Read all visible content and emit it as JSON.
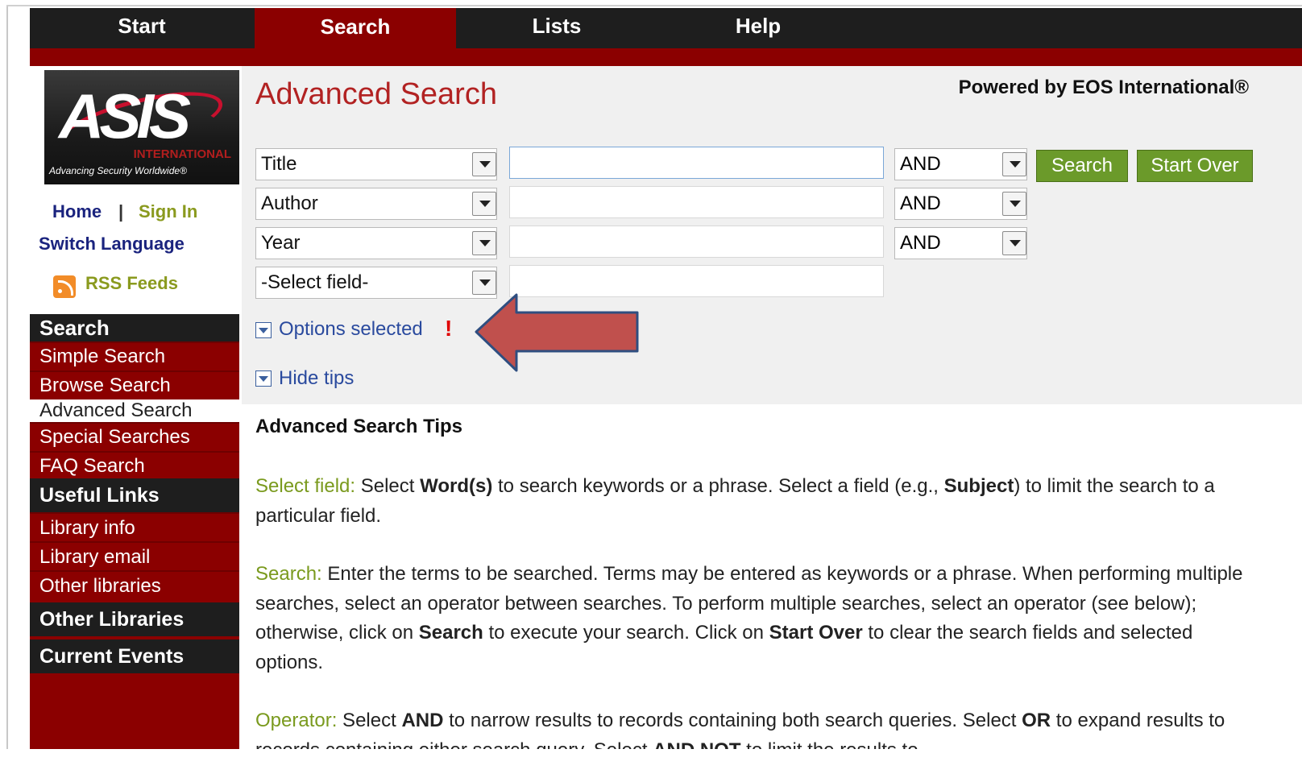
{
  "topnav": {
    "tabs": [
      {
        "label": "Start",
        "active": false
      },
      {
        "label": "Search",
        "active": true
      },
      {
        "label": "Lists",
        "active": false
      },
      {
        "label": "Help",
        "active": false
      }
    ]
  },
  "logo": {
    "main": "ASIS",
    "sub1": "INTERNATIONAL",
    "sub2": "Advancing Security Worldwide®"
  },
  "header": {
    "title": "Advanced Search",
    "powered_by": "Powered by EOS International®"
  },
  "sidebar": {
    "home": "Home",
    "separator": "|",
    "sign_in": "Sign In",
    "switch_language": "Switch Language",
    "rss": "RSS Feeds",
    "search_heading": "Search",
    "search_items": [
      "Simple Search",
      "Browse Search",
      "Advanced Search",
      "Special Searches",
      "FAQ Search"
    ],
    "useful_links_heading": "Useful Links",
    "useful_links": [
      "Library info",
      "Library email",
      "Other libraries"
    ],
    "other_libraries_heading": "Other Libraries",
    "current_events_heading": "Current Events"
  },
  "search_form": {
    "rows": [
      {
        "field": "Title",
        "value": "",
        "operator": "AND"
      },
      {
        "field": "Author",
        "value": "",
        "operator": "AND"
      },
      {
        "field": "Year",
        "value": "",
        "operator": "AND"
      },
      {
        "field": "-Select field-",
        "value": ""
      }
    ],
    "search_button": "Search",
    "start_over_button": "Start Over",
    "options_selected": "Options selected",
    "options_flag": "!",
    "hide_tips": "Hide tips"
  },
  "tips": {
    "title": "Advanced Search Tips",
    "select_field": {
      "label": "Select field:",
      "t1": " Select ",
      "b1": "Word(s)",
      "t2": " to search keywords or a phrase. Select a field (e.g., ",
      "b2": "Subject",
      "t3": ") to limit the search to a particular field."
    },
    "search": {
      "label": "Search:",
      "t1": " Enter the terms to be searched. Terms may be entered as keywords or a phrase. When performing multiple searches, select an operator between searches. To perform multiple searches, select an operator (see below); otherwise, click on ",
      "b1": "Search",
      "t2": " to execute your search. Click on ",
      "b2": "Start Over",
      "t3": " to clear the search fields and selected options."
    },
    "operator": {
      "label": "Operator:",
      "t1": " Select ",
      "b1": "AND",
      "t2": " to narrow results to records containing both search queries. Select ",
      "b2": "OR",
      "t3": " to expand results to records containing either search query. Select ",
      "b3": "AND NOT",
      "t4": " to limit the results to"
    }
  },
  "colors": {
    "brand_red": "#8b0000",
    "nav_black": "#1e1e1e",
    "title_red": "#b22222",
    "button_green": "#6b9a2a",
    "label_green": "#7a9a1e",
    "annotation_arrow": "#c0504d"
  }
}
